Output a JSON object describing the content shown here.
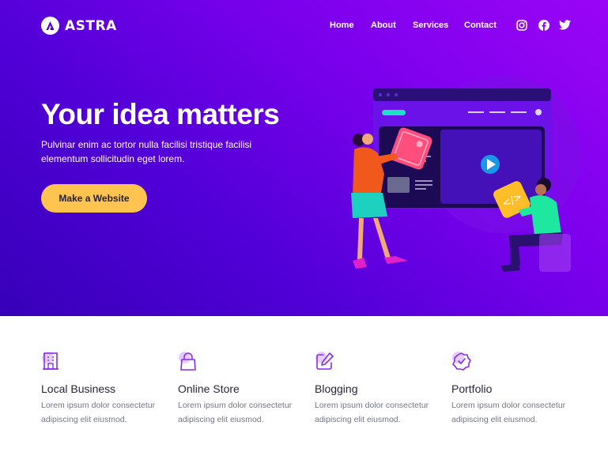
{
  "header": {
    "brand": "ASTRA",
    "logo_icon": "astra-logo-icon",
    "nav": [
      {
        "label": "Home"
      },
      {
        "label": "About"
      },
      {
        "label": "Services"
      },
      {
        "label": "Contact"
      }
    ],
    "social": [
      {
        "icon": "instagram-icon"
      },
      {
        "icon": "facebook-icon"
      },
      {
        "icon": "twitter-icon"
      }
    ]
  },
  "hero": {
    "title": "Your idea matters",
    "subtitle": "Pulvinar enim ac tortor nulla facilisi tristique facilisi elementum sollicitudin eget lorem.",
    "cta_label": "Make a Website",
    "illustration": "website-builder-illustration",
    "colors": {
      "gradient_start": "#3600b8",
      "gradient_end": "#9a05f6",
      "cta_bg": "#ffc44f"
    }
  },
  "features": [
    {
      "icon": "building-icon",
      "title": "Local Business",
      "desc": "Lorem ipsum dolor consectetur adipiscing elit eiusmod."
    },
    {
      "icon": "shopping-bag-icon",
      "title": "Online Store",
      "desc": "Lorem ipsum dolor consectetur adipiscing elit eiusmod."
    },
    {
      "icon": "edit-icon",
      "title": "Blogging",
      "desc": "Lorem ipsum dolor consectetur adipiscing elit eiusmod."
    },
    {
      "icon": "badge-check-icon",
      "title": "Portfolio",
      "desc": "Lorem ipsum dolor consectetur adipiscing elit eiusmod."
    }
  ]
}
